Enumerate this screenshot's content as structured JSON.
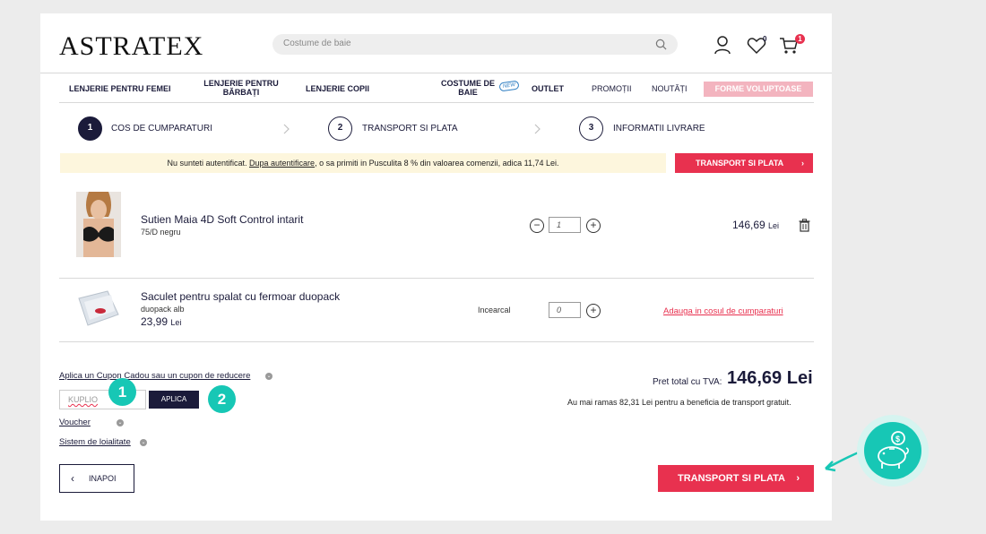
{
  "header": {
    "logo": "ASTRATEX",
    "search_placeholder": "Costume de baie",
    "wishlist_count": "0",
    "cart_count": "1"
  },
  "nav": {
    "items": [
      "LENJERIE PENTRU FEMEI",
      "LENJERIE PENTRU BĂRBAȚI",
      "LENJERIE COPII",
      "COSTUME DE BAIE",
      "OUTLET",
      "PROMOȚII",
      "NOUTĂȚI",
      "FORME VOLUPTOASE"
    ],
    "new_tag": "NEW"
  },
  "steps": [
    {
      "num": "1",
      "label": "COS DE CUMPARATURI"
    },
    {
      "num": "2",
      "label": "TRANSPORT SI PLATA"
    },
    {
      "num": "3",
      "label": "INFORMATII LIVRARE"
    }
  ],
  "notice": {
    "text_before": "Nu sunteti autentificat. ",
    "link": "Dupa autentificare",
    "text_after": ", o sa primiti in Pusculita 8 % din valoarea comenzii, adica 11,74 Lei.",
    "button": "TRANSPORT SI PLATA"
  },
  "cart": {
    "items": [
      {
        "name": "Sutien Maia 4D Soft Control intarit",
        "variant": "75/D negru",
        "qty": "1",
        "price": "146,69",
        "currency": "Lei"
      }
    ],
    "suggestion": {
      "name": "Saculet pentru spalat cu fermoar duopack",
      "variant": "duopack alb",
      "price": "23,99",
      "currency": "Lei",
      "try_label": "Incearcal",
      "qty": "0",
      "add_link": "Adauga in cosul de cumparaturi"
    }
  },
  "coupon": {
    "link": "Aplica un Cupon Cadou sau un cupon de reducere",
    "input_value": "KUPLIO",
    "apply": "APLICA",
    "marker1": "1",
    "marker2": "2",
    "voucher": "Voucher",
    "loyalty": "Sistem de loialitate"
  },
  "totals": {
    "label": "Pret total cu TVA:",
    "value": "146,69 Lei",
    "shipping_note": "Au mai ramas 82,31 Lei pentru a beneficia de transport gratuit."
  },
  "footer": {
    "back": "INAPOI",
    "next": "TRANSPORT SI PLATA"
  },
  "colors": {
    "accent": "#e8314f",
    "navy": "#1b1b3a",
    "teal": "#17c7b5"
  }
}
